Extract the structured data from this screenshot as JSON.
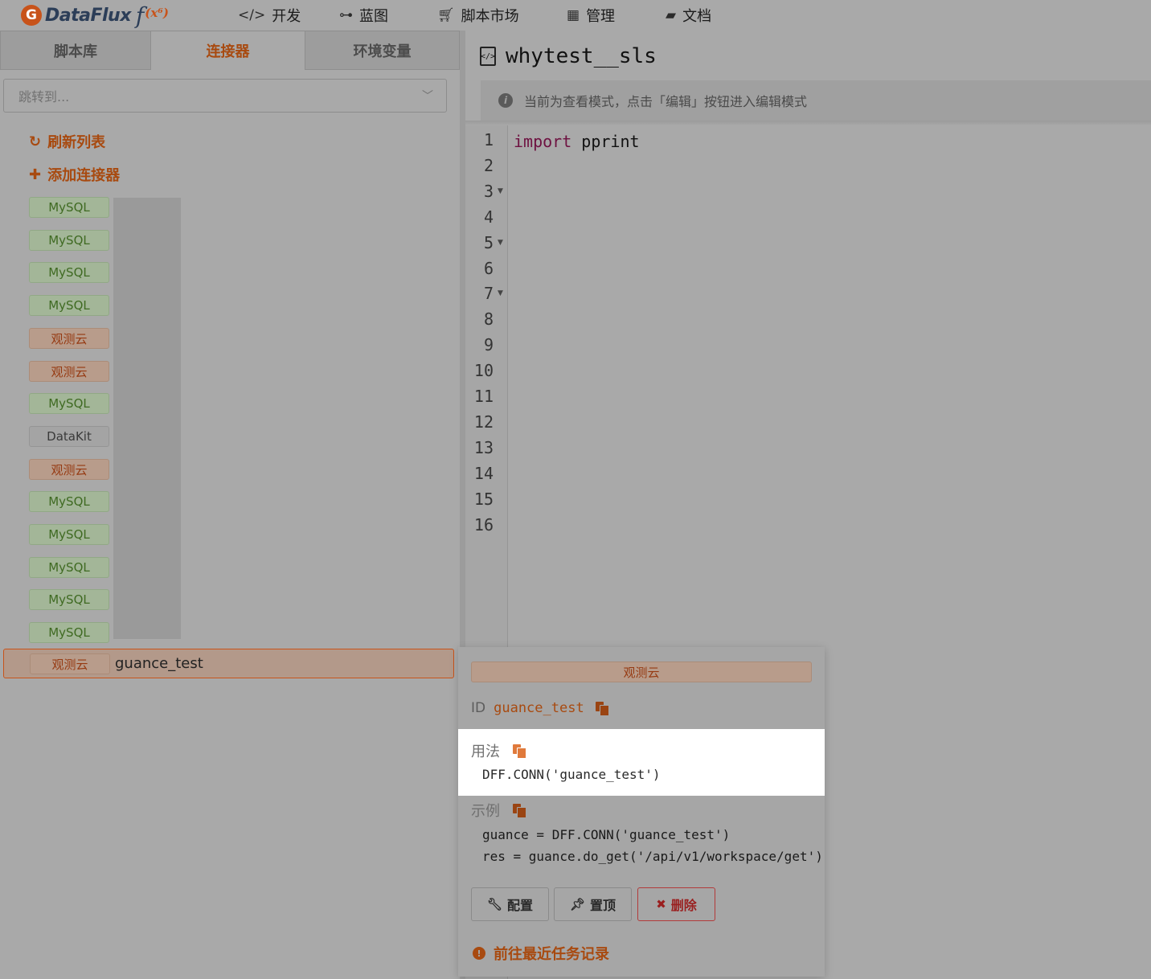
{
  "app": {
    "logo_text": "DataFlux",
    "logo_fx": "f",
    "logo_sup": "(x⁶)"
  },
  "nav": [
    {
      "label": "开发",
      "icon": "code-icon"
    },
    {
      "label": "蓝图",
      "icon": "blueprint-icon"
    },
    {
      "label": "脚本市场",
      "icon": "cart-icon"
    },
    {
      "label": "管理",
      "icon": "grid-icon"
    },
    {
      "label": "文档",
      "icon": "book-icon"
    }
  ],
  "sidebar": {
    "tabs": [
      "脚本库",
      "连接器",
      "环境变量"
    ],
    "active_tab": "连接器",
    "jump_placeholder": "跳转到...",
    "refresh_label": "刷新列表",
    "add_label": "添加连接器",
    "connectors": [
      {
        "type": "MySQL",
        "kind": "mysql"
      },
      {
        "type": "MySQL",
        "kind": "mysql"
      },
      {
        "type": "MySQL",
        "kind": "mysql"
      },
      {
        "type": "MySQL",
        "kind": "mysql"
      },
      {
        "type": "观测云",
        "kind": "guance"
      },
      {
        "type": "观测云",
        "kind": "guance"
      },
      {
        "type": "MySQL",
        "kind": "mysql"
      },
      {
        "type": "DataKit",
        "kind": "datakit"
      },
      {
        "type": "观测云",
        "kind": "guance"
      },
      {
        "type": "MySQL",
        "kind": "mysql"
      },
      {
        "type": "MySQL",
        "kind": "mysql"
      },
      {
        "type": "MySQL",
        "kind": "mysql"
      },
      {
        "type": "MySQL",
        "kind": "mysql"
      },
      {
        "type": "MySQL",
        "kind": "mysql"
      }
    ],
    "selected": {
      "type": "观测云",
      "name": "guance_test"
    }
  },
  "editor": {
    "file_name": "whytest__sls",
    "notice": "当前为查看模式，点击「编辑」按钮进入编辑模式",
    "line_numbers": [
      "1",
      "2",
      "3",
      "4",
      "5",
      "6",
      "7",
      "8",
      "9",
      "10",
      "11",
      "12",
      "13",
      "14",
      "15",
      "16"
    ],
    "fold_lines": [
      3,
      5,
      7
    ],
    "code_keyword": "import",
    "code_ident": "pprint"
  },
  "popover": {
    "type_badge": "观测云",
    "id_label": "ID",
    "id_value": "guance_test",
    "usage_label": "用法",
    "usage_code": "DFF.CONN('guance_test')",
    "example_label": "示例",
    "example_line1": "guance = DFF.CONN('guance_test')",
    "example_line2": "res = guance.do_get('/api/v1/workspace/get')",
    "btn_config": "配置",
    "btn_pin": "置顶",
    "btn_delete": "删除",
    "recent_link": "前往最近任务记录"
  },
  "colors": {
    "accent": "#a84a10",
    "mysql_badge": "#3f6a22",
    "guance_badge": "#963a12",
    "overlay_bg": "#a9a9a9"
  }
}
